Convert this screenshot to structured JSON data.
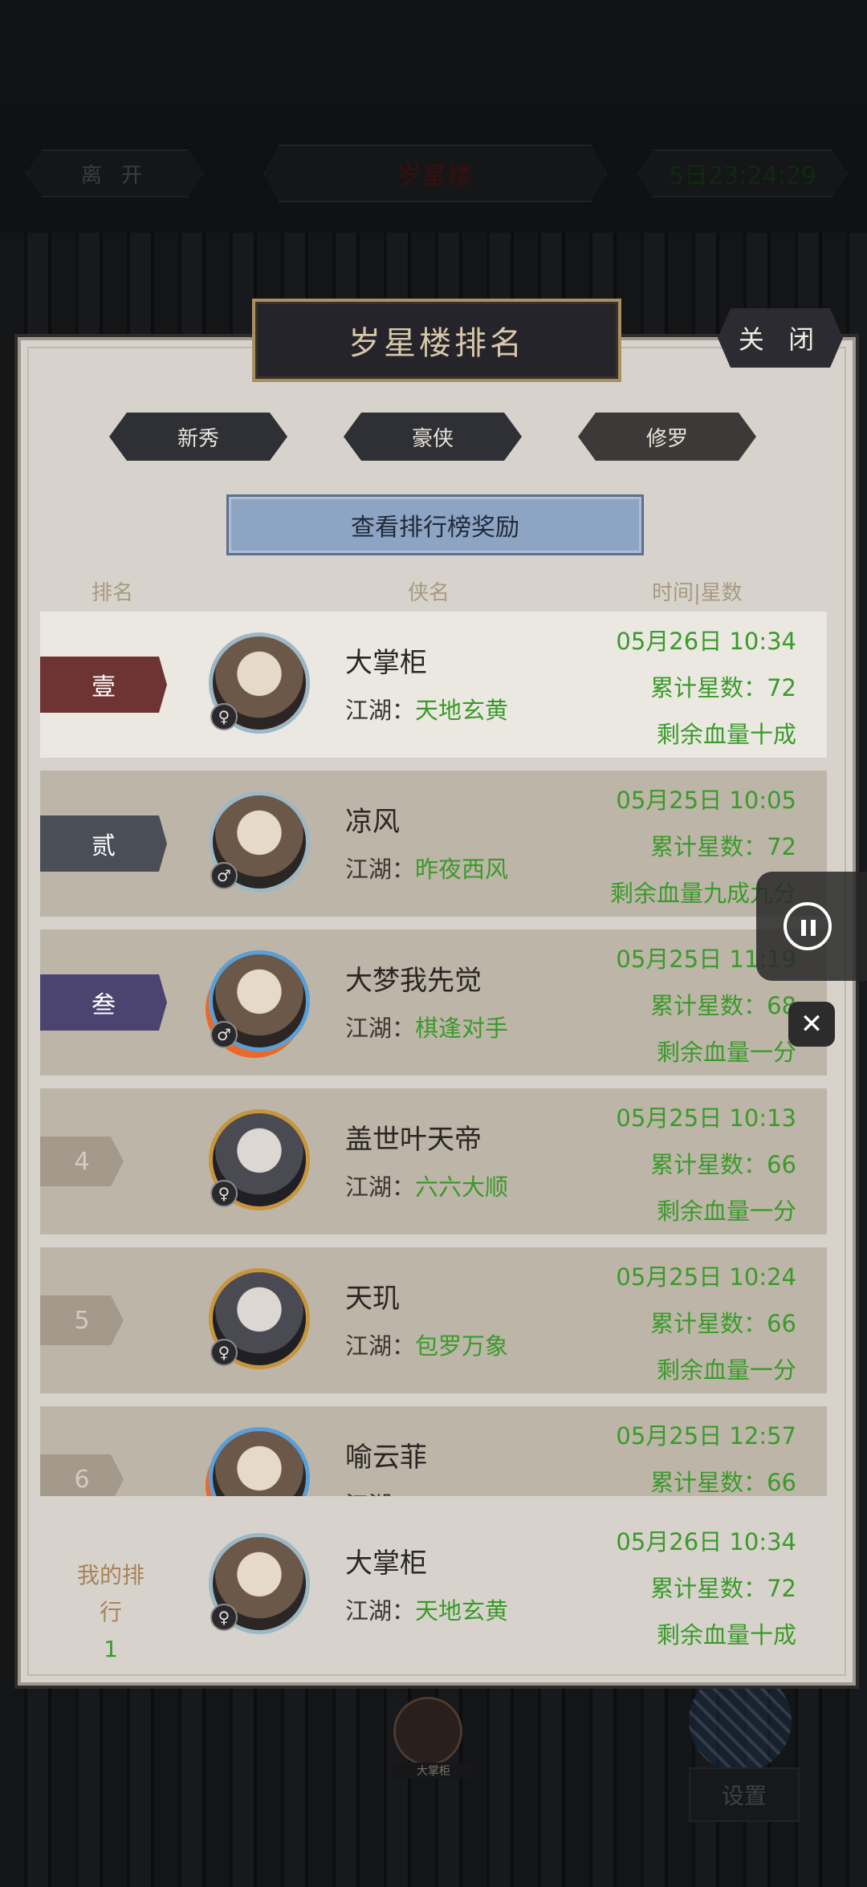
{
  "topbar": {
    "leave": "离 开",
    "location": "岁星楼",
    "timer": "5日23:24:29"
  },
  "panel": {
    "title": "岁星楼排名",
    "close": "关 闭",
    "tabs": [
      "新秀",
      "豪侠",
      "修罗"
    ],
    "active_tab": "修罗",
    "reward_button": "查看排行榜奖励",
    "headers": {
      "rank": "排名",
      "name": "侠名",
      "time_stars": "时间|星数"
    }
  },
  "rows": [
    {
      "rank": "壹",
      "rank_color": "#6e3434",
      "gender": "♀",
      "name": "大掌柜",
      "guild_label": "江湖：",
      "guild": "天地玄黄",
      "time": "05月26日 10:34",
      "stars": "累计星数：72",
      "hp": "剩余血量十成",
      "avatar_style": "silver"
    },
    {
      "rank": "贰",
      "rank_color": "#4a4e57",
      "gender": "♂",
      "name": "凉风",
      "guild_label": "江湖：",
      "guild": "昨夜西风",
      "time": "05月25日 10:05",
      "stars": "累计星数：72",
      "hp": "剩余血量九成九分",
      "avatar_style": "silver"
    },
    {
      "rank": "叁",
      "rank_color": "#4c4470",
      "gender": "♂",
      "name": "大梦我先觉",
      "guild_label": "江湖：",
      "guild": "棋逢对手",
      "time": "05月25日 11:19",
      "stars": "累计星数：68",
      "hp": "剩余血量一分",
      "avatar_style": "fire"
    },
    {
      "rank": "4",
      "gender": "♀",
      "name": "盖世叶天帝",
      "guild_label": "江湖：",
      "guild": "六六大顺",
      "time": "05月25日 10:13",
      "stars": "累计星数：66",
      "hp": "剩余血量一分",
      "avatar_style": "gold"
    },
    {
      "rank": "5",
      "gender": "♀",
      "name": "天玑",
      "guild_label": "江湖：",
      "guild": "包罗万象",
      "time": "05月25日 10:24",
      "stars": "累计星数：66",
      "hp": "剩余血量一分",
      "avatar_style": "gold"
    },
    {
      "rank": "6",
      "gender": "♀",
      "name": "喻云菲",
      "guild_label": "江湖：",
      "guild": "",
      "time": "05月25日 12:57",
      "stars": "累计星数：66",
      "hp": "",
      "avatar_style": "fire"
    }
  ],
  "my_rank": {
    "label": "我的排行",
    "value": "1",
    "gender": "♀",
    "name": "大掌柜",
    "guild_label": "江湖：",
    "guild": "天地玄黄",
    "time": "05月26日 10:34",
    "stars": "累计星数：72",
    "hp": "剩余血量十成"
  },
  "bottom": {
    "player_tag": "大掌柜",
    "settings": "设置"
  }
}
